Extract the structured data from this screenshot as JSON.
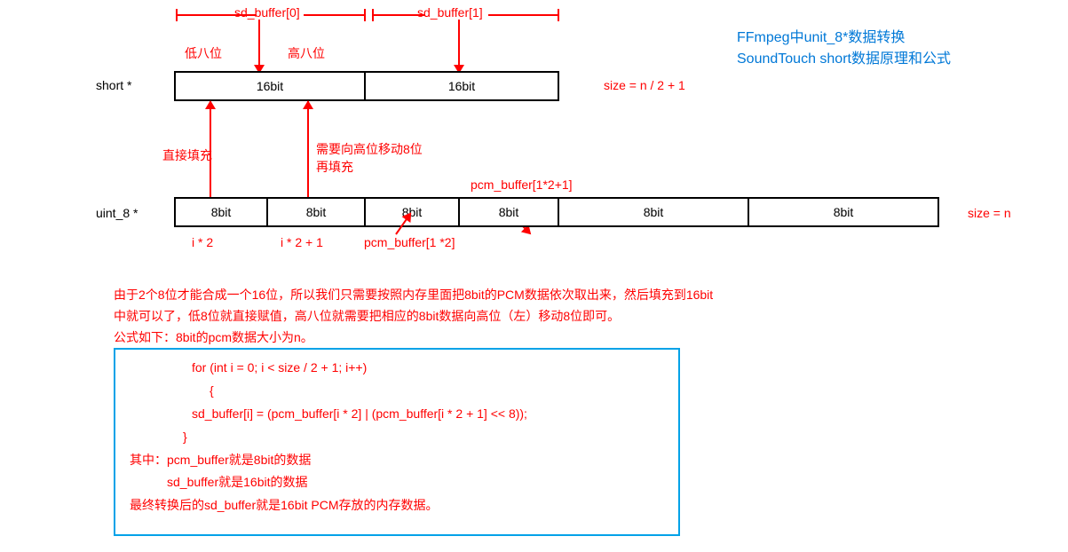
{
  "title1": "FFmpeg中unit_8*数据转换",
  "title2": "SoundTouch short数据原理和公式",
  "short_label": "short *",
  "uint8_label": "uint_8 *",
  "cells16": [
    "16bit",
    "16bit"
  ],
  "cells8": [
    "8bit",
    "8bit",
    "8bit",
    "8bit",
    "8bit",
    "8bit"
  ],
  "sd0": "sd_buffer[0]",
  "sd1": "sd_buffer[1]",
  "low8": "低八位",
  "high8": "高八位",
  "size_half": "size = n / 2 + 1",
  "size_n": "size = n",
  "direct_fill": "直接填充",
  "shift_fill1": "需要向高位移动8位",
  "shift_fill2": "再填充",
  "idx0": "i * 2",
  "idx1": "i * 2 + 1",
  "pcm0": "pcm_buffer[1 *2]",
  "pcm1": "pcm_buffer[1*2+1]",
  "para1": "由于2个8位才能合成一个16位，所以我们只需要按照内存里面把8bit的PCM数据依次取出来，然后填充到16bit",
  "para2": "中就可以了，低8位就直接赋值，高八位就需要把相应的8bit数据向高位（左）移动8位即可。",
  "para3": "公式如下：8bit的pcm数据大小为n。",
  "code1": "for (int i = 0; i < size / 2 + 1; i++)",
  "code2": "{",
  "code3": "sd_buffer[i] = (pcm_buffer[i * 2] | (pcm_buffer[i * 2 + 1] << 8));",
  "code4": "}",
  "note1": "其中：pcm_buffer就是8bit的数据",
  "note2": "sd_buffer就是16bit的数据",
  "note3": "最终转换后的sd_buffer就是16bit PCM存放的内存数据。"
}
